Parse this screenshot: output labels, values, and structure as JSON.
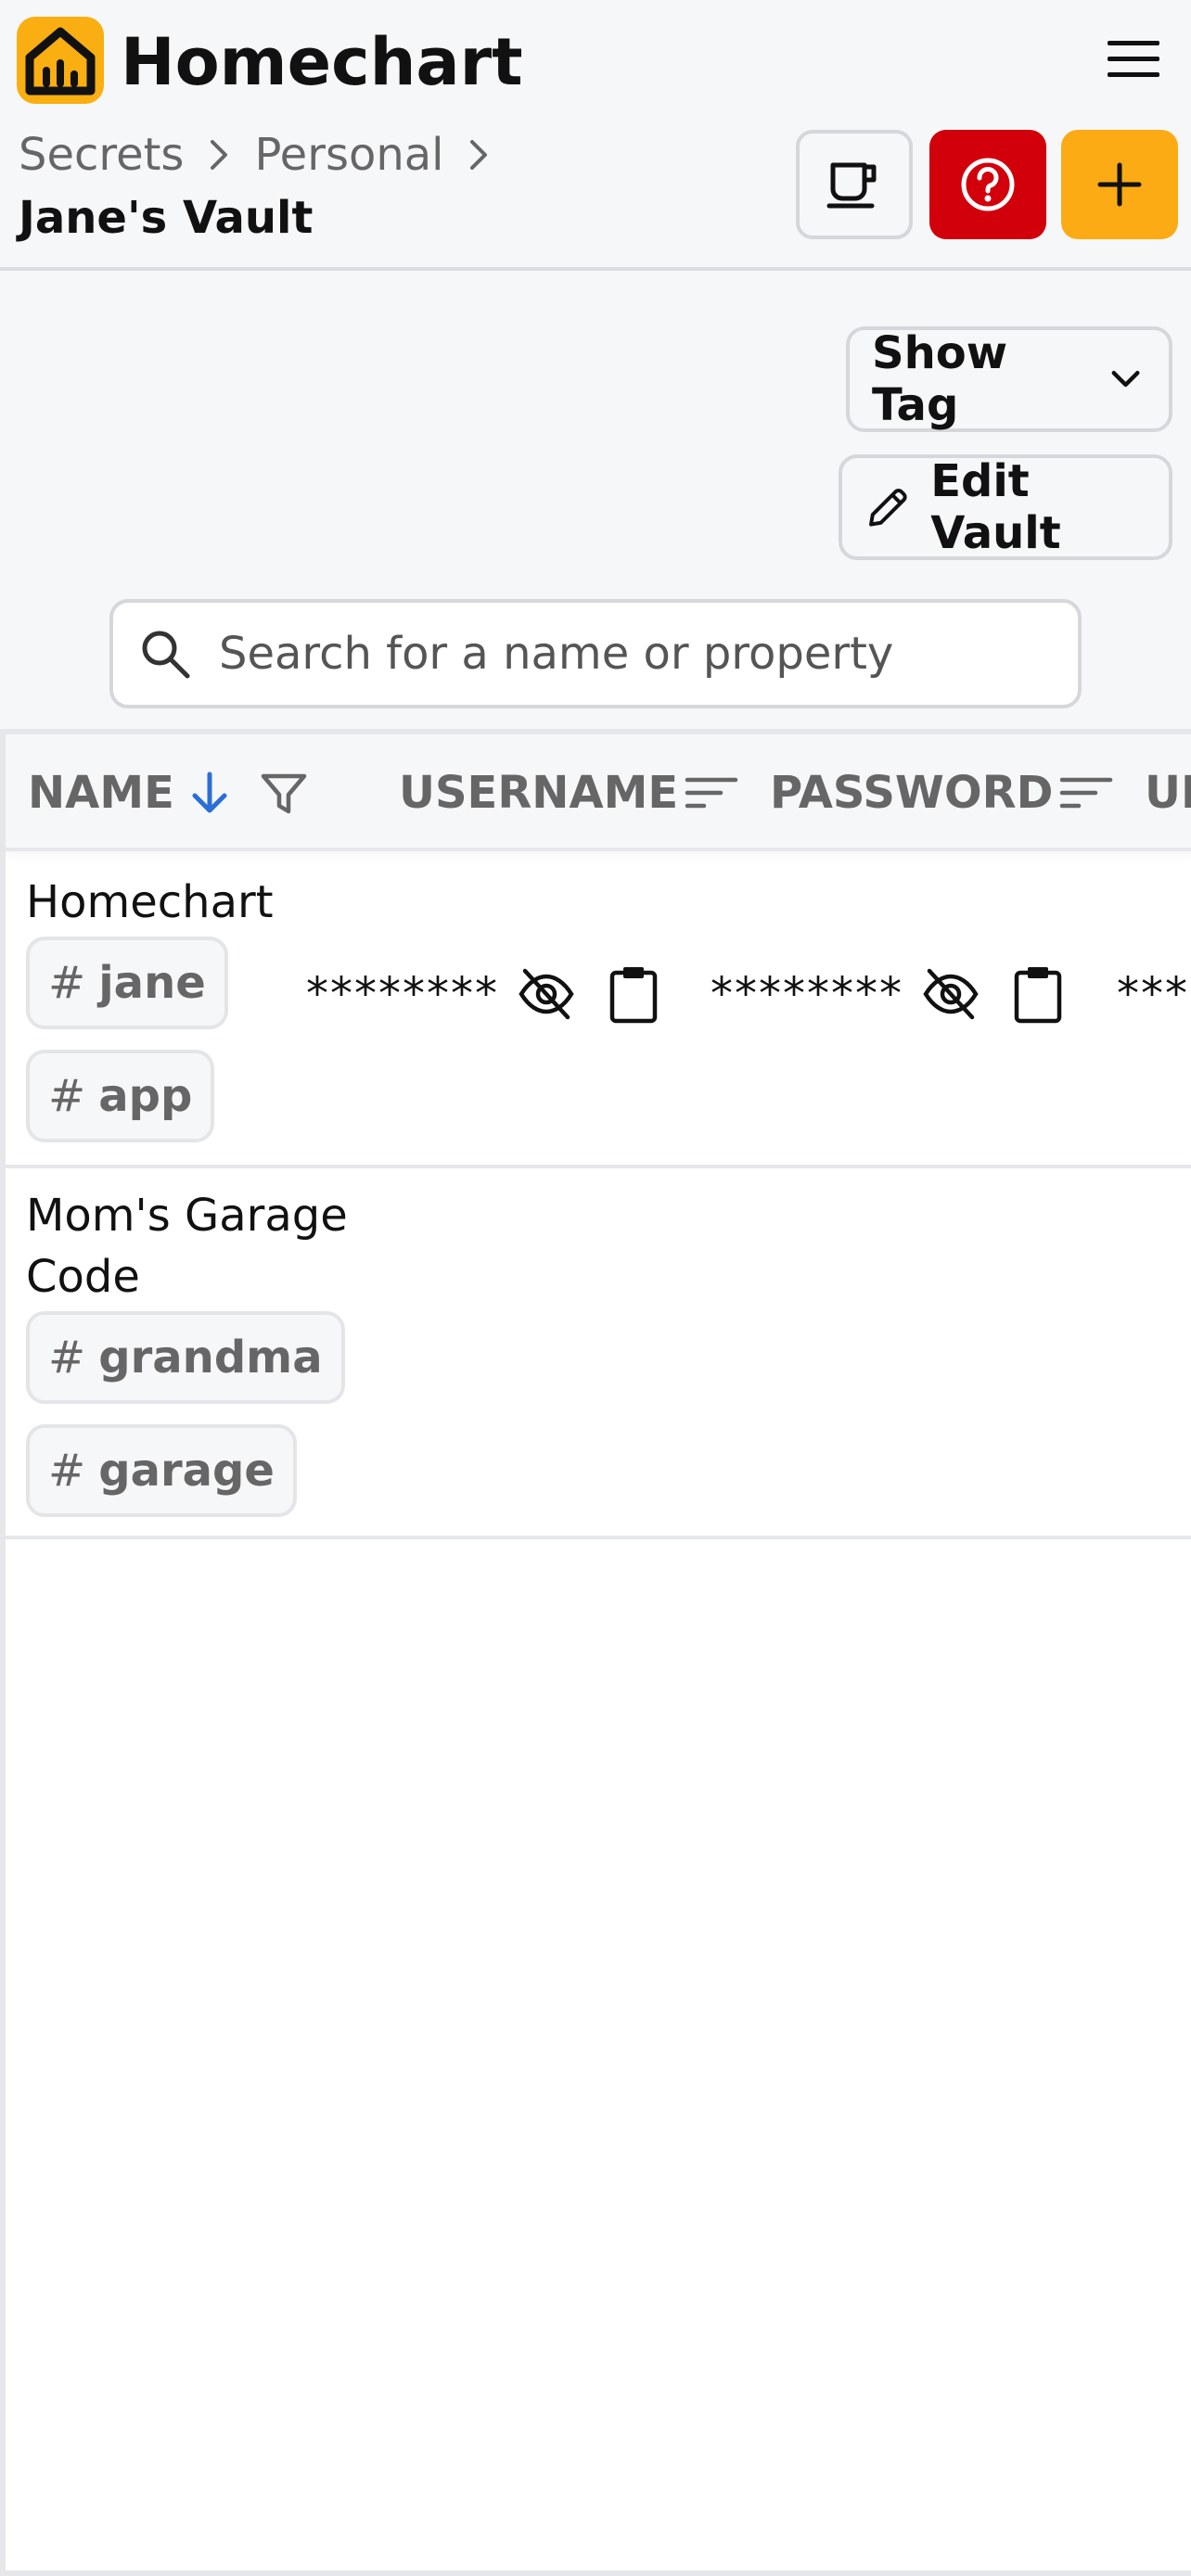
{
  "app": {
    "title": "Homechart"
  },
  "breadcrumb": {
    "items": [
      "Secrets",
      "Personal"
    ],
    "current": "Jane's Vault"
  },
  "header_buttons": {
    "cup": "cup-icon",
    "help": "help-icon",
    "add": "plus-icon"
  },
  "toolbar": {
    "show_tag": "Show Tag",
    "edit_vault": "Edit Vault"
  },
  "search": {
    "placeholder": "Search for a name or property",
    "value": ""
  },
  "table": {
    "columns": [
      "NAME",
      "USERNAME",
      "PASSWORD",
      "UI"
    ],
    "rows": [
      {
        "name": "Homechart",
        "tags": [
          "jane",
          "app"
        ],
        "username": "********",
        "password": "********",
        "url": "***"
      },
      {
        "name": "Mom's Garage Code",
        "tags": [
          "grandma",
          "garage"
        ]
      }
    ]
  },
  "colors": {
    "brand": "#f9ae11",
    "help": "#d1000a",
    "add": "#fcab14",
    "sort_active": "#2b6fd6"
  }
}
